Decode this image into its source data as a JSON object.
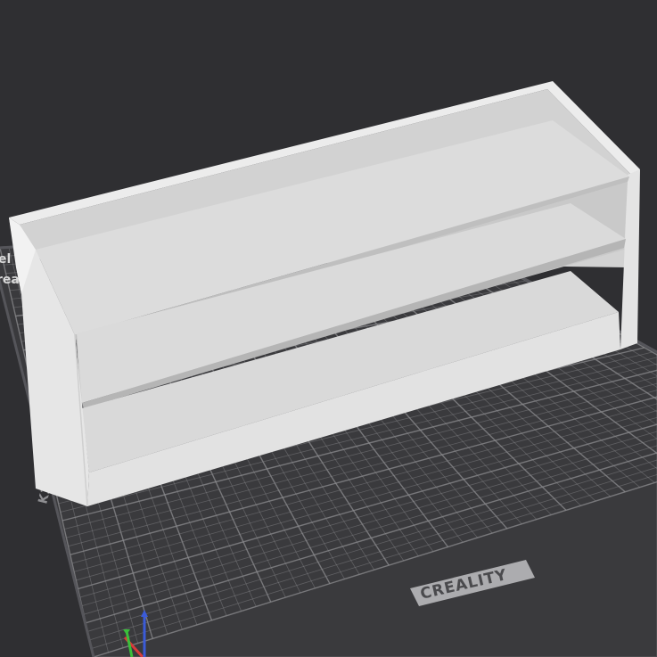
{
  "viewport": {
    "background": "#2f2f32",
    "bed": {
      "brand_label": "CREALITY",
      "corner_label_top": "el",
      "corner_label_mid": "rea",
      "side_label": "K1",
      "surface_color": "#3a3a3d",
      "grid_color": "#8c8c8f",
      "frame_color": "#4a4a4d"
    },
    "model": {
      "name": "three-shelf-organizer",
      "color": "#dedede"
    },
    "axes": {
      "x_color": "#d83b3b",
      "y_color": "#3bbf3b",
      "z_color": "#3b5bd8"
    }
  }
}
